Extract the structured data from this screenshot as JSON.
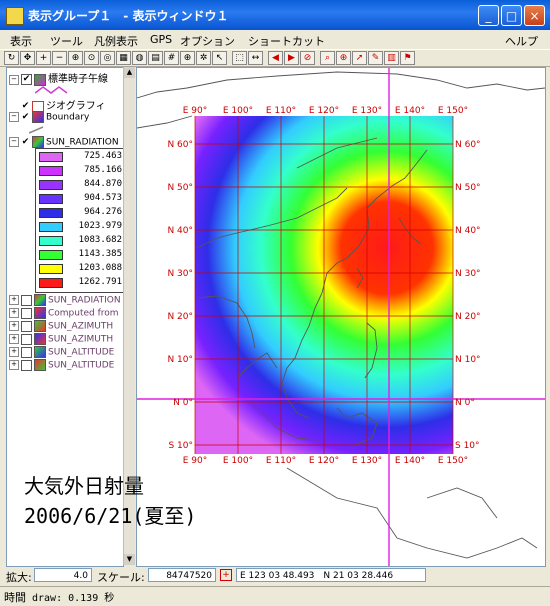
{
  "window": {
    "title": "表示グループ１　- 表示ウィンドウ１"
  },
  "menu": {
    "items": [
      "表示",
      "ツール",
      "凡例表示",
      "GPS",
      "オプション",
      "ショートカット"
    ],
    "help": "ヘルプ"
  },
  "layers": [
    {
      "name": "標準時子午線",
      "checked": true
    },
    {
      "name": "ジオグラフィ",
      "checked": true
    },
    {
      "name": "Boundary",
      "checked": true
    },
    {
      "name": "SUN_RADIATION",
      "checked": true
    }
  ],
  "legend": {
    "values": [
      "725.463",
      "785.166",
      "844.870",
      "904.573",
      "964.276",
      "1023.979",
      "1083.682",
      "1143.385",
      "1203.088",
      "1262.791"
    ],
    "colors": [
      "#dd66f5",
      "#cc33ff",
      "#9933ff",
      "#6633ff",
      "#2e2ee8",
      "#33ccff",
      "#33ffcc",
      "#33ff33",
      "#ffff00",
      "#ff1a1a"
    ]
  },
  "other_layers": [
    "SUN_RADIATION",
    "Computed from",
    "SUN_AZIMUTH",
    "SUN_AZIMUTH",
    "SUN_ALTITUDE",
    "SUN_ALTITUDE"
  ],
  "map": {
    "lon_labels": [
      "E 90°",
      "E 100°",
      "E 110°",
      "E 120°",
      "E 130°",
      "E 140°",
      "E 150°"
    ],
    "lat_labels": [
      "N 60°",
      "N 50°",
      "N 40°",
      "N 30°",
      "N 20°",
      "N 10°",
      "N 0°",
      "S 10°"
    ],
    "caption_line1": "大気外日射量",
    "caption_line2": "2006/6/21(夏至)"
  },
  "status": {
    "zoom_label": "拡大:",
    "zoom_value": "4.0",
    "scale_label": "スケール:",
    "scale_value": "84747520",
    "coords": "E 123 03 48.493　N 21 03 28.446",
    "time_label": "時間",
    "draw_time": "draw: 0.139 秒"
  }
}
